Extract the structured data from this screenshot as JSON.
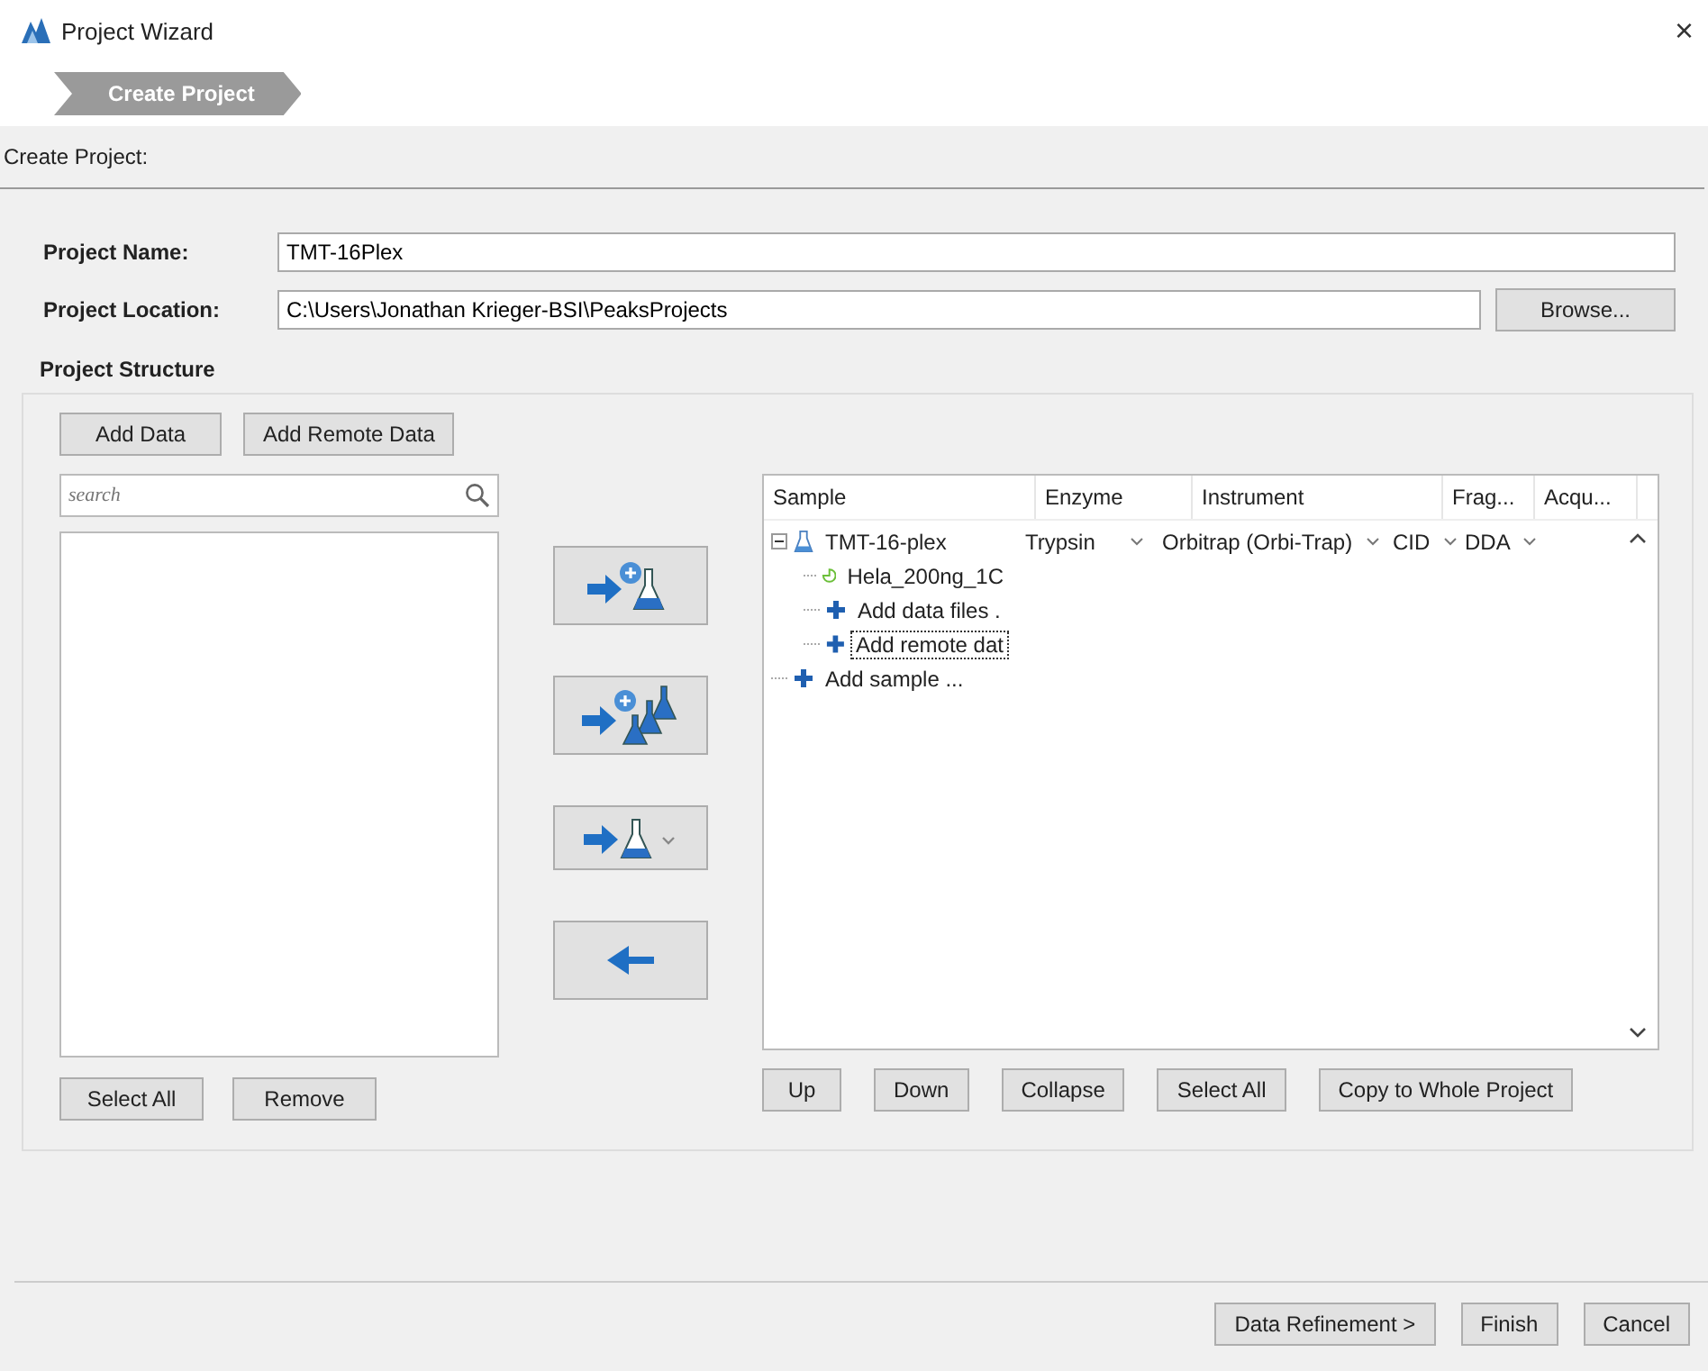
{
  "window": {
    "title": "Project Wizard",
    "close": "×"
  },
  "steps": [
    {
      "label": "Create Project",
      "selected": true
    }
  ],
  "section_title": "Create Project:",
  "fields": [
    {
      "label": "Project Name:",
      "value": "TMT-16Plex"
    },
    {
      "label": "Project Location:",
      "value": "C:\\Users\\Jonathan Krieger-BSI\\PeaksProjects",
      "button": "Browse..."
    }
  ],
  "structure": {
    "title": "Project Structure",
    "top_buttons": [
      "Add Data",
      "Add Remote Data"
    ],
    "search": {
      "placeholder": "search"
    },
    "left_buttons": [
      "Select All",
      "Remove"
    ],
    "middle_buttons": [
      {
        "kind": "add-sample"
      },
      {
        "kind": "add-samples"
      },
      {
        "kind": "sample-menu"
      },
      {
        "kind": "remove"
      }
    ],
    "tree": {
      "columns": [
        "Sample",
        "Enzyme",
        "Instrument",
        "Frag...",
        "Acqu..."
      ],
      "rows": [
        {
          "kind": "sample",
          "label": "TMT-16-plex",
          "expanded": true,
          "enzyme": "Trypsin",
          "instrument": "Orbitrap (Orbi-Trap)",
          "frag": "CID",
          "acq": "DDA",
          "focused": false,
          "children": [
            {
              "kind": "file",
              "label": "Hela_200ng_1C",
              "focused": false
            },
            {
              "kind": "add",
              "label": "Add data files .",
              "focused": false
            },
            {
              "kind": "add",
              "label": "Add remote dat",
              "focused": true
            }
          ]
        },
        {
          "kind": "add",
          "label": "Add sample ...",
          "focused": false
        }
      ]
    },
    "right_buttons": [
      "Up",
      "Down",
      "Collapse",
      "Select All",
      "Copy to Whole Project"
    ]
  },
  "footer_buttons": [
    "Data Refinement >",
    "Finish",
    "Cancel"
  ]
}
